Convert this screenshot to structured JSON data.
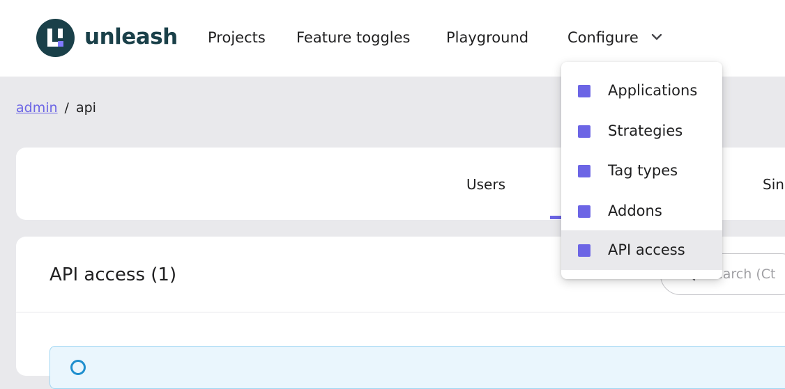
{
  "brand": {
    "name": "unleash"
  },
  "nav": {
    "projects": "Projects",
    "feature_toggles": "Feature toggles",
    "playground": "Playground",
    "configure": "Configure"
  },
  "breadcrumb": {
    "link": "admin",
    "separator": "/",
    "current": "api"
  },
  "tabs": {
    "users": "Users",
    "partial": "Sin"
  },
  "main": {
    "title": "API access (1)",
    "search_placeholder": "Search (Ct"
  },
  "configure_menu": {
    "items": [
      {
        "label": "Applications",
        "icon": "square-icon"
      },
      {
        "label": "Strategies",
        "icon": "square-icon"
      },
      {
        "label": "Tag types",
        "icon": "square-icon"
      },
      {
        "label": "Addons",
        "icon": "square-icon"
      },
      {
        "label": "API access",
        "icon": "square-icon",
        "selected": true
      }
    ]
  },
  "colors": {
    "brand_dark": "#1a4049",
    "accent": "#6c65e5",
    "logo_dot": "#817afe",
    "background": "#e9e9ec",
    "info_border": "#9fd6f2",
    "info_fill": "#eaf6fd"
  }
}
